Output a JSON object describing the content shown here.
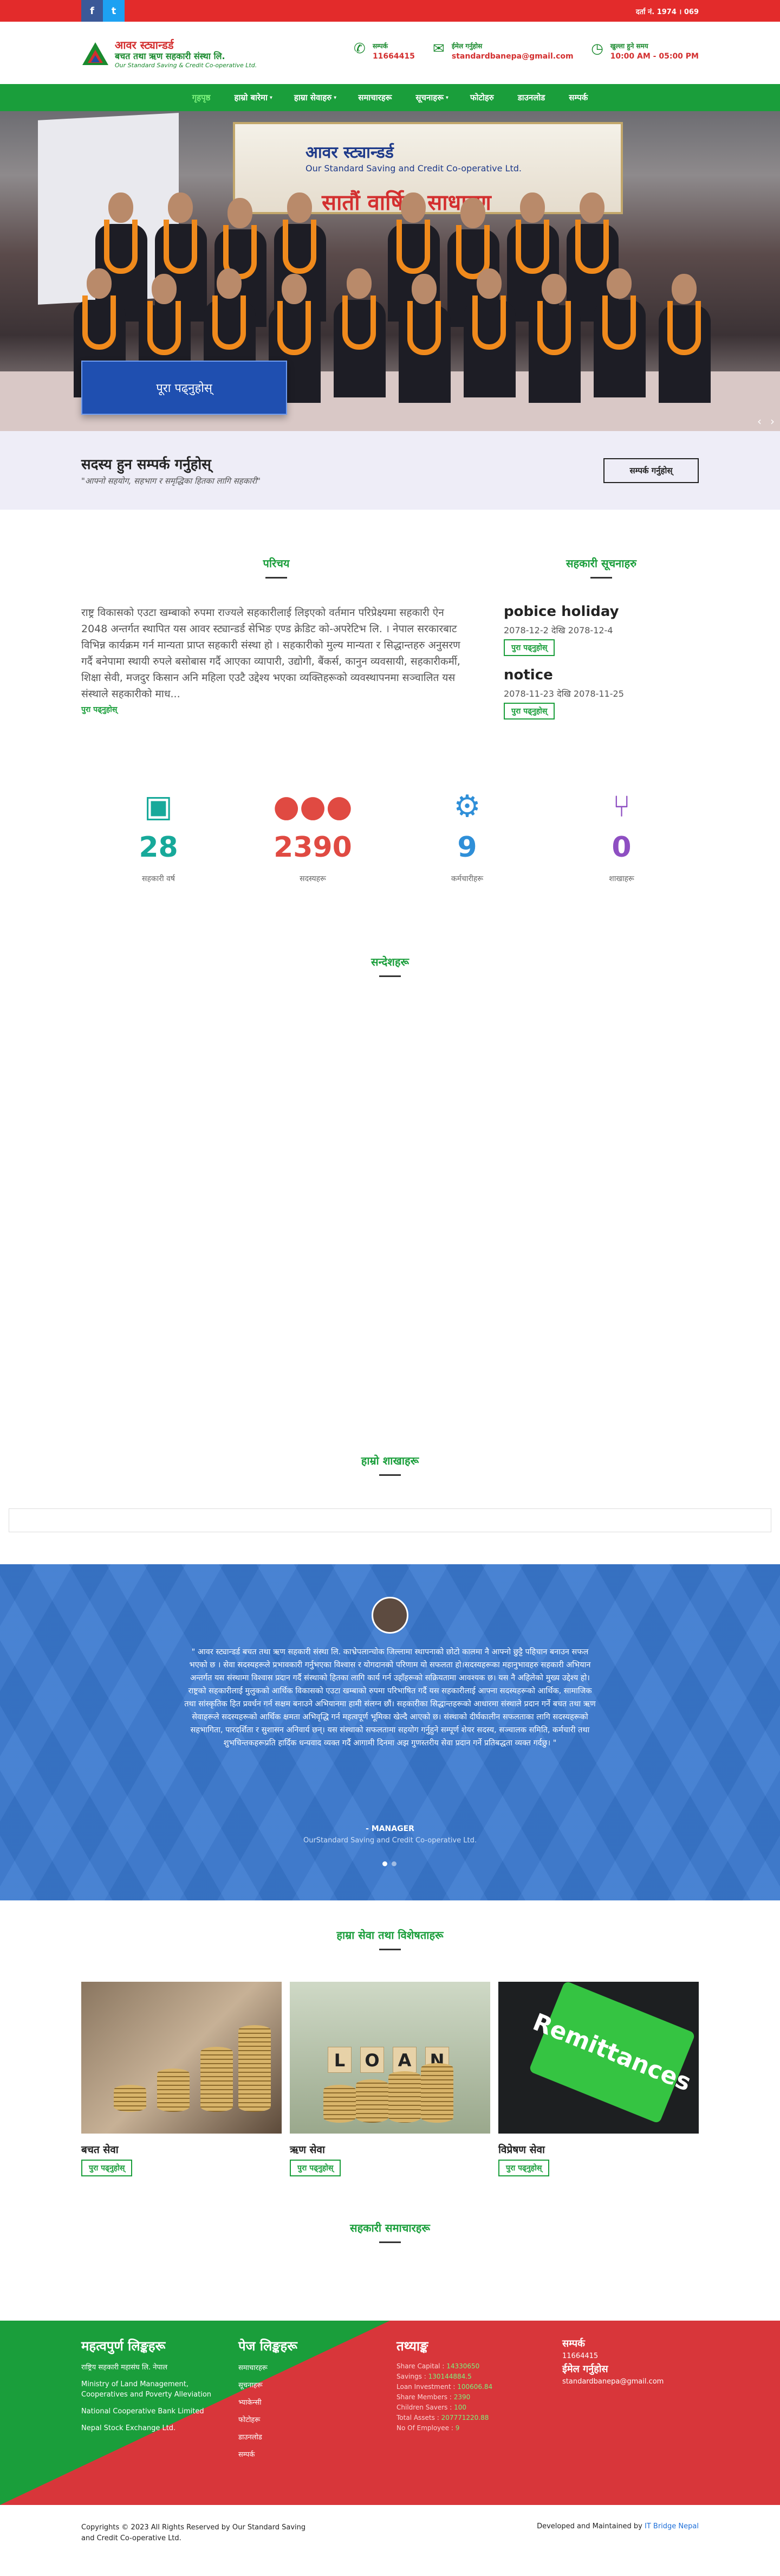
{
  "topbar": {
    "facebook": "f",
    "twitter": "t",
    "registration": "दर्ता नं. 1974 । 069"
  },
  "logo": {
    "line1": "आवर स्ट्यान्डर्ड",
    "line2": "बचत तथा ऋण सहकारी संस्था लि.",
    "line3": "Our Standard Saving & Credit Co-operative Ltd."
  },
  "contacts": [
    {
      "icon": "phone-icon",
      "title": "सम्पर्क",
      "value": "11664415"
    },
    {
      "icon": "mail-icon",
      "title": "ईमेल गर्नुहोस",
      "value": "standardbanepa@gmail.com"
    },
    {
      "icon": "clock-icon",
      "title": "खुल्ला हुने समय",
      "value": "10:00 AM - 05:00 PM"
    }
  ],
  "nav": [
    {
      "label": "गृहपृष्ठ",
      "active": true,
      "caret": false
    },
    {
      "label": "हाम्रो बारेमा",
      "active": false,
      "caret": true
    },
    {
      "label": "हाम्रा सेवाहरु",
      "active": false,
      "caret": true
    },
    {
      "label": "समाचारहरू",
      "active": false,
      "caret": false
    },
    {
      "label": "सूचनाहरू",
      "active": false,
      "caret": true
    },
    {
      "label": "फोटोहरु",
      "active": false,
      "caret": false
    },
    {
      "label": "डाउनलोड",
      "active": false,
      "caret": false
    },
    {
      "label": "सम्पर्क",
      "active": false,
      "caret": false
    }
  ],
  "hero": {
    "banner_title": "आवर स्ट्यान्डर्ड",
    "banner_sub": "Our Standard Saving and Credit Co-operative Ltd.",
    "banner_event": "सातौं वार्षिक साधारण",
    "cta": "पूरा पढ्नुहोस्",
    "prev": "‹",
    "next": "›"
  },
  "join": {
    "title": "सदस्य हुन सम्पर्क गर्नुहोस्",
    "subtitle": "\"आफ्नो सहयोग, सहभाग र समृद्धिका हितका लागि सहकारी\"",
    "button": "सम्पर्क गर्नुहोस्"
  },
  "about": {
    "title": "परिचय",
    "text": "राष्ट्र विकासको एउटा खम्बाको रुपमा राज्यले सहकारीलाई लिइएको वर्तमान परिप्रेक्ष्यमा सहकारी ऐन 2048 अन्तर्गत स्थापित यस आवर स्ट्यान्डर्ड सेभिङ एण्ड क्रेडिट को-अपरेटिभ लि. । नेपाल सरकारबाट विभिन्न कार्यक्रम गर्न मान्यता प्राप्त सहकारी संस्था हो । सहकारीको मुल्य मान्यता र सिद्धान्तहरु अनुसरण गर्दै बनेपामा स्थायी रुपले बसोबास गर्दै आएका व्यापारी, उद्योगी, बैंकर्स, कानुन व्यवसायी, सहकारीकर्मी, शिक्षा सेवी, मजदुर किसान अनि महिला एउटै उद्देश्य भएका व्यक्तिहरूको व्यवस्थापनमा सञ्चालित यस संस्थाले सहकारीको माध...",
    "readmore": "पुरा पढ्नुहोस्"
  },
  "notices": {
    "title": "सहकारी सूचनाहरु",
    "items": [
      {
        "title": "pobice holiday",
        "date": "2078-12-2 देखि 2078-12-4",
        "button": "पुरा पढ्नुहोस्"
      },
      {
        "title": "notice",
        "date": "2078-11-23 देखि 2078-11-25",
        "button": "पुरा पढ्नुहोस्"
      }
    ]
  },
  "stats": [
    {
      "icon": "calendar-check-icon",
      "value": "28",
      "label": "सहकारी वर्ष",
      "color": "#17a99a"
    },
    {
      "icon": "users-icon",
      "value": "2390",
      "label": "सदस्यहरू",
      "color": "#e04a42"
    },
    {
      "icon": "staff-gear-icon",
      "value": "9",
      "label": "कर्मचारीहरू",
      "color": "#2f8fd8"
    },
    {
      "icon": "branch-icon",
      "value": "0",
      "label": "शाखाहरू",
      "color": "#8e4fc2"
    }
  ],
  "messages": {
    "title": "सन्देशहरू"
  },
  "branches": {
    "title": "हाम्रो शाखाहरू"
  },
  "testimonial": {
    "quote": "\" आवर स्ट्यान्डर्ड बचत तथा ऋण सहकारी संस्था लि. काभ्रेपलान्चोक जिल्लामा स्थापनाको छोटो कालमा नै आफ्नो छुट्टै पहिचान बनाउन सफल भएको छ । सेवा सदस्यहरूले प्रभावकारी गर्नुभएका विश्वास र योगदानको परिणाम यो सफलता हो।सदस्यहरूका महानुभावहरु सहकारी अभियान अन्तर्गत यस संस्थामा विश्वास प्रदान गर्दै संस्थाको हितका लागि कार्य गर्न उहाँहरूको सक्रियतामा आवश्यक छ। यस नै अहिलेको मुख्य उद्देश्य हो। राष्ट्रको सहकारीलाई मुलुकको आर्थिक विकासको एउटा खम्बाको रुपमा परिभाषित गर्दै यस सहकारीलाई आफ्ना सदस्यहरूको आर्थिक, सामाजिक तथा सांस्कृतिक हित प्रवर्धन गर्न सक्षम बनाउने अभियानमा हामी संलग्न छौं। सहकारीका सिद्धान्तहरूको आधारमा संस्थाले प्रदान गर्ने बचत तथा ऋण सेवाहरूले सदस्यहरूको आर्थिक क्षमता अभिवृद्धि गर्न महत्वपूर्ण भूमिका खेल्दै आएको छ। संस्थाको दीर्घकालीन सफलताका लागि सदस्यहरूको सहभागिता, पारदर्शिता र सुशासन अनिवार्य छन्। यस संस्थाको सफलतामा सहयोग गर्नुहुने सम्पूर्ण शेयर सदस्य, सञ्चालक समिति, कर्मचारी तथा शुभचिन्तकहरूप्रति हार्दिक धन्यवाद व्यक्त गर्दै आगामी दिनमा अझ गुणस्तरीय सेवा प्रदान गर्ने प्रतिबद्धता व्यक्त गर्दछु। \"",
    "author": "- MANAGER",
    "org": "OurStandard Saving and Credit Co-operative Ltd."
  },
  "features": {
    "title": "हाम्रा सेवा तथा विशेषताहरू",
    "cards": [
      {
        "title": "बचत सेवा",
        "button": "पुरा पढ्नुहोस्"
      },
      {
        "title": "ऋण सेवा",
        "button": "पुरा पढ्नुहोस्",
        "blocks": [
          "L",
          "O",
          "A",
          "N"
        ]
      },
      {
        "title": "विप्रेषण सेवा",
        "button": "पुरा पढ्नुहोस्",
        "key": "Remittances"
      }
    ]
  },
  "news": {
    "title": "सहकारी समाचारहरू"
  },
  "footer": {
    "links_title": "महत्वपुर्ण लिङ्कहरू",
    "links": [
      "राष्ट्रिय सहकारी महासंघ लि. नेपाल",
      "Ministry of Land Management, Cooperatives and Poverty Alleviation",
      "National Cooperative Bank Limited",
      "Nepal Stock Exchange Ltd."
    ],
    "pages_title": "पेज लिङ्कहरू",
    "pages": [
      "समाचारहरू",
      "सूचनाहरू",
      "भ्याकेन्सी",
      "फोटोहरू",
      "डाउनलोड",
      "सम्पर्क"
    ],
    "facts_title": "तथ्याङ्क",
    "facts": [
      {
        "label": "Share Capital : ",
        "value": "14330650"
      },
      {
        "label": "Savings : ",
        "value": "130144884.5"
      },
      {
        "label": "Loan Investment : ",
        "value": "100606.84"
      },
      {
        "label": "Share Members : ",
        "value": "2390"
      },
      {
        "label": "Children Savers : ",
        "value": "100"
      },
      {
        "label": "Total Assets : ",
        "value": "207771220.88"
      },
      {
        "label": "No Of Employee : ",
        "value": "9"
      }
    ],
    "contact_title": "सम्पर्क",
    "phone": "11664415",
    "email_title": "ईमेल गर्नुहोस",
    "email": "standardbanepa@gmail.com"
  },
  "copyright": {
    "left": "Copyrights © 2023 All Rights Reserved by Our Standard Saving and Credit Co-operative Ltd.",
    "right_prefix": "Developed and Maintained by ",
    "right_link": "IT Bridge Nepal"
  }
}
